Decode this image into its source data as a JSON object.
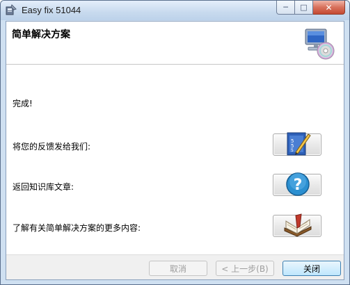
{
  "window": {
    "title": "Easy fix 51044",
    "controls": {
      "minimize": "─",
      "maximize": "□",
      "close": "✕"
    }
  },
  "header": {
    "title": "简单解决方案",
    "icon": "computer-with-cd-icon"
  },
  "main": {
    "status": "完成!",
    "actions": [
      {
        "label": "将您的反馈发给我们:",
        "icon": "feedback-form-icon"
      },
      {
        "label": "返回知识库文章:",
        "icon": "help-question-icon"
      },
      {
        "label": "了解有关简单解决方案的更多内容:",
        "icon": "open-book-icon"
      }
    ]
  },
  "footer": {
    "cancel_label": "取消",
    "back_label": "< 上一步(B)",
    "close_label": "关闭"
  },
  "colors": {
    "titlebar": "#c8daee",
    "frame": "#cfe0f1",
    "help_blue": "#2b8fd0"
  }
}
